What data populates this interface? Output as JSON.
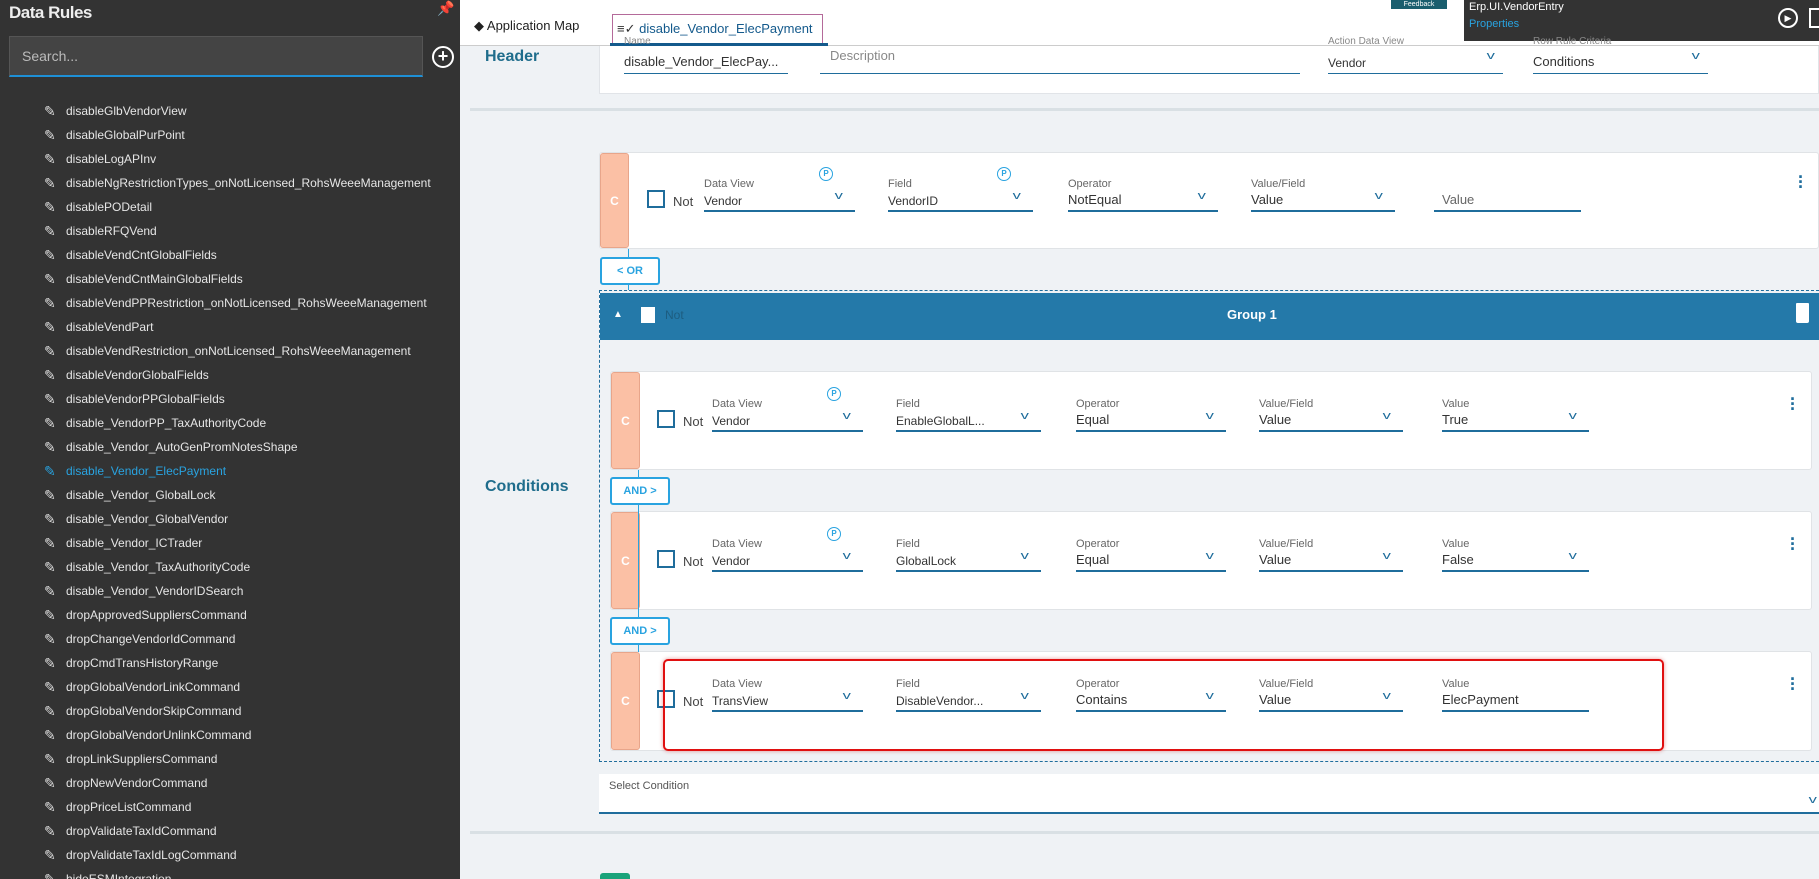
{
  "sidebar": {
    "title": "Data Rules",
    "search_placeholder": "Search...",
    "active_index": 15,
    "items": [
      "disableGlbVendorView",
      "disableGlobalPurPoint",
      "disableLogAPInv",
      "disableNgRestrictionTypes_onNotLicensed_RohsWeeeManagement",
      "disablePODetail",
      "disableRFQVend",
      "disableVendCntGlobalFields",
      "disableVendCntMainGlobalFields",
      "disableVendPPRestriction_onNotLicensed_RohsWeeeManagement",
      "disableVendPart",
      "disableVendRestriction_onNotLicensed_RohsWeeeManagement",
      "disableVendorGlobalFields",
      "disableVendorPPGlobalFields",
      "disable_VendorPP_TaxAuthorityCode",
      "disable_Vendor_AutoGenPromNotesShape",
      "disable_Vendor_ElecPayment",
      "disable_Vendor_GlobalLock",
      "disable_Vendor_GlobalVendor",
      "disable_Vendor_ICTrader",
      "disable_Vendor_TaxAuthorityCode",
      "disable_Vendor_VendorIDSearch",
      "dropApprovedSuppliersCommand",
      "dropChangeVendorIdCommand",
      "dropCmdTransHistoryRange",
      "dropGlobalVendorLinkCommand",
      "dropGlobalVendorSkipCommand",
      "dropGlobalVendorUnlinkCommand",
      "dropLinkSuppliersCommand",
      "dropNewVendorCommand",
      "dropPriceListCommand",
      "dropValidateTaxIdCommand",
      "dropValidateTaxIdLogCommand",
      "hideESMIntegration"
    ]
  },
  "tabs": {
    "app_map": "Application Map",
    "rule": "disable_Vendor_ElecPayment"
  },
  "feedback": "Feedback",
  "top_panel": {
    "title": "Erp.UI.VendorEntry",
    "link": "Properties"
  },
  "header": {
    "label": "Header",
    "name_label": "Name",
    "name_value": "disable_Vendor_ElecPay...",
    "description_placeholder": "Description",
    "action_dv_label": "Action Data View",
    "action_dv_value": "Vendor",
    "criteria_label": "Row Rule Criteria",
    "criteria_value": "Conditions"
  },
  "conditions": {
    "label": "Conditions",
    "badge": "C",
    "not_label": "Not",
    "labels": {
      "data_view": "Data View",
      "field": "Field",
      "operator": "Operator",
      "value_field": "Value/Field",
      "value": "Value"
    },
    "param_tag": "P",
    "rows": [
      {
        "data_view": "Vendor",
        "field": "VendorID",
        "operator": "NotEqual",
        "value_field": "Value",
        "value": "",
        "value_placeholder": "Value",
        "dv_param": true,
        "field_param": true,
        "value_dropdown": false
      },
      {
        "data_view": "Vendor",
        "field": "EnableGlobalL...",
        "operator": "Equal",
        "value_field": "Value",
        "value": "True",
        "dv_param": true,
        "field_param": false,
        "value_dropdown": true
      },
      {
        "data_view": "Vendor",
        "field": "GlobalLock",
        "operator": "Equal",
        "value_field": "Value",
        "value": "False",
        "dv_param": true,
        "field_param": false,
        "value_dropdown": true
      },
      {
        "data_view": "TransView",
        "field": "DisableVendor...",
        "operator": "Contains",
        "value_field": "Value",
        "value": "ElecPayment",
        "dv_param": false,
        "field_param": false,
        "value_dropdown": false
      }
    ],
    "or_label": "< OR",
    "and_label": "AND >",
    "group": {
      "title": "Group 1",
      "not_label": "Not"
    },
    "select_condition": "Select Condition"
  },
  "colors": {
    "accent": "#2479a9",
    "link": "#29a3e0",
    "badge": "#fbc0a5",
    "highlight": "#e01010",
    "sidebar": "#333333"
  }
}
